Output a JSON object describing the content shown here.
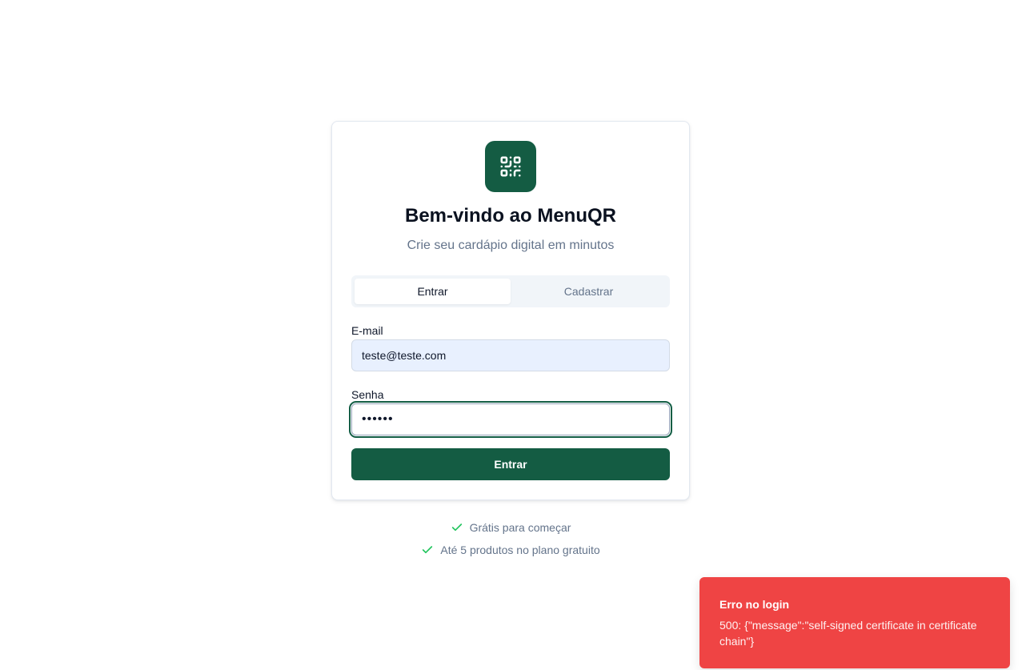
{
  "card": {
    "title": "Bem-vindo ao MenuQR",
    "subtitle": "Crie seu cardápio digital em minutos",
    "logo_icon": "qr-code-icon",
    "logo_color": "#145c43"
  },
  "tabs": [
    {
      "label": "Entrar",
      "active": true
    },
    {
      "label": "Cadastrar",
      "active": false
    }
  ],
  "form": {
    "email_label": "E-mail",
    "email_value": "teste@teste.com",
    "password_label": "Senha",
    "password_value": "••••••",
    "submit_label": "Entrar"
  },
  "features": [
    {
      "icon": "check-icon",
      "text": "Grátis para começar"
    },
    {
      "icon": "check-icon",
      "text": "Até 5 produtos no plano gratuito"
    }
  ],
  "toast": {
    "title": "Erro no login",
    "message": "500: {\"message\":\"self-signed certificate in certificate chain\"}",
    "color": "#ef4444"
  },
  "colors": {
    "accent": "#145c43",
    "check": "#22c55e",
    "error": "#ef4444"
  }
}
